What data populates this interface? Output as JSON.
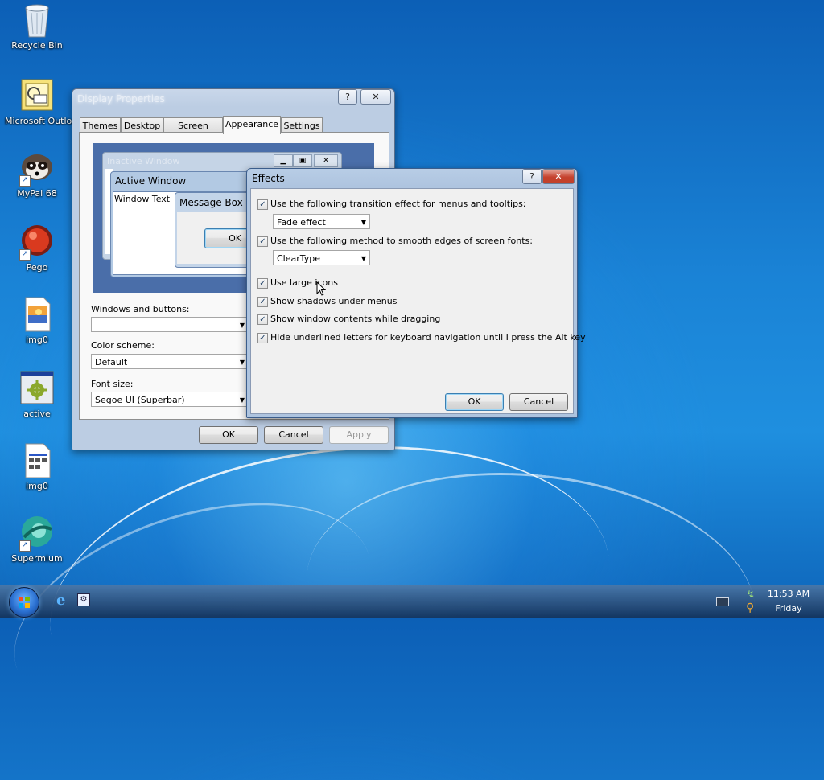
{
  "desktop": {
    "icons": [
      {
        "label": "Recycle Bin"
      },
      {
        "label": "Microsoft Outlook"
      },
      {
        "label": "MyPal 68"
      },
      {
        "label": "Pego"
      },
      {
        "label": "img0"
      },
      {
        "label": "active"
      },
      {
        "label": "img0"
      },
      {
        "label": "Supermium"
      }
    ]
  },
  "display_properties": {
    "title": "Display Properties",
    "help_button": "?",
    "close_button": "✕",
    "tabs": [
      "Themes",
      "Desktop",
      "Screen Saver",
      "Appearance",
      "Settings"
    ],
    "active_tab": "Appearance",
    "preview": {
      "inactive_window": "Inactive Window",
      "active_window": "Active Window",
      "window_text": "Window Text",
      "message_box": "Message Box",
      "ok": "OK"
    },
    "windows_and_buttons_label": "Windows and buttons:",
    "windows_and_buttons_value": "",
    "color_scheme_label": "Color scheme:",
    "color_scheme_value": "Default",
    "font_size_label": "Font size:",
    "font_size_value": "Segoe UI (Superbar)",
    "ok": "OK",
    "cancel": "Cancel",
    "apply": "Apply"
  },
  "effects": {
    "title": "Effects",
    "help_button": "?",
    "close_button": "✕",
    "transition_label": "Use the following transition effect for menus and tooltips:",
    "transition_value": "Fade effect",
    "smooth_label": "Use the following method to smooth edges of screen fonts:",
    "smooth_value": "ClearType",
    "options": [
      {
        "label": "Use large icons",
        "checked": true
      },
      {
        "label": "Show shadows under menus",
        "checked": true
      },
      {
        "label": "Show window contents while dragging",
        "checked": true
      },
      {
        "label": "Hide underlined letters for keyboard navigation until I press the Alt key",
        "checked": true
      }
    ],
    "ok": "OK",
    "cancel": "Cancel"
  },
  "taskbar": {
    "time": "11:53 AM",
    "day": "Friday"
  },
  "colors": {
    "accent": "#3c7fb1",
    "close": "#c5412d"
  }
}
